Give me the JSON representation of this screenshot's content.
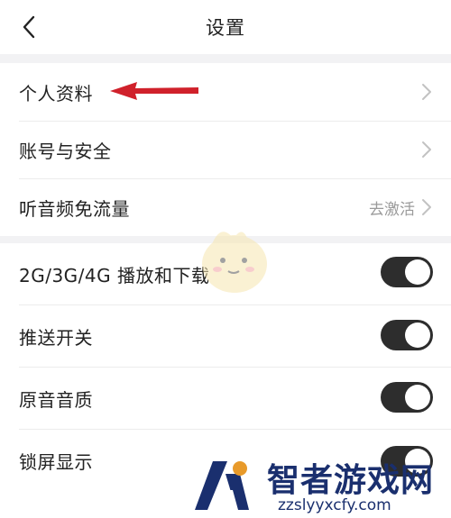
{
  "header": {
    "title": "设置"
  },
  "account_group": {
    "items": [
      {
        "label": "个人资料"
      },
      {
        "label": "账号与安全"
      },
      {
        "label": "听音频免流量",
        "action_text": "去激活"
      }
    ]
  },
  "playback_group": {
    "items": [
      {
        "label": "2G/3G/4G 播放和下载",
        "enabled": true
      },
      {
        "label": "推送开关",
        "enabled": true
      },
      {
        "label": "原音音质",
        "enabled": true
      },
      {
        "label": "锁屏显示",
        "enabled": true
      }
    ]
  },
  "watermark": {
    "title": "智者游戏网",
    "url": "zzslyyxcfy.com"
  },
  "colors": {
    "annotation_arrow": "#d0212b",
    "toggle_on": "#2d2d2d",
    "watermark": "#1a2f6e"
  }
}
